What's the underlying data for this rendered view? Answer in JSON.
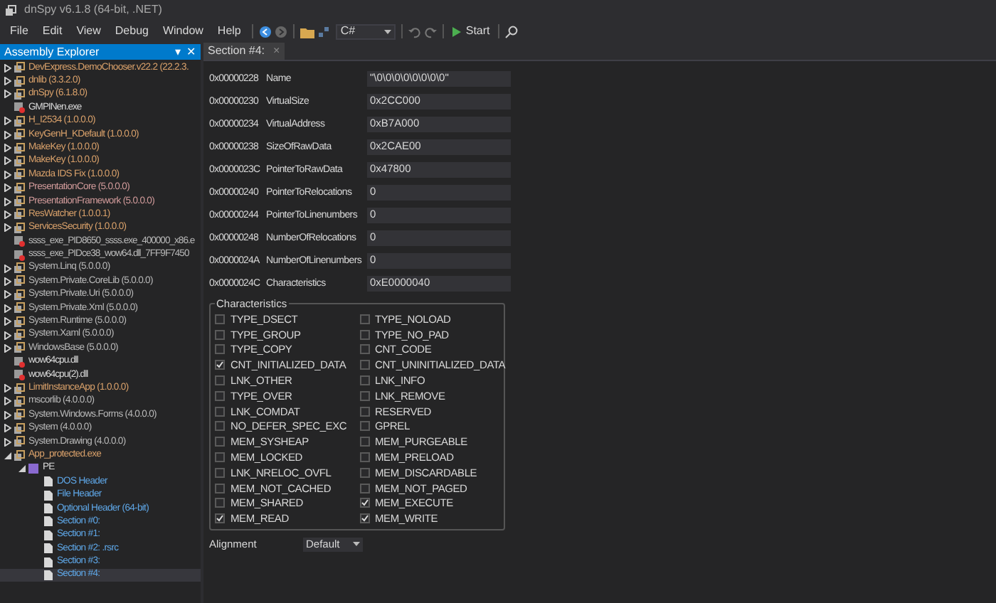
{
  "window": {
    "title": "dnSpy v6.1.8 (64-bit, .NET)"
  },
  "menu": [
    "File",
    "Edit",
    "View",
    "Debug",
    "Window",
    "Help"
  ],
  "toolbar": {
    "language": "C#",
    "start": "Start"
  },
  "explorer": {
    "title": "Assembly Explorer",
    "pin": "▾",
    "close": "✕",
    "items": [
      {
        "label": "DevExpress.DemoChooser.v22.2 (22.2.3.",
        "kind": "assembly",
        "color": "#d8a06a",
        "expanded": false,
        "selected": false
      },
      {
        "label": "dnlib (3.3.2.0)",
        "kind": "assembly",
        "color": "#d8a06a",
        "expanded": false,
        "selected": false
      },
      {
        "label": "dnSpy (6.1.8.0)",
        "kind": "assembly",
        "color": "#d8a06a",
        "expanded": false,
        "selected": false
      },
      {
        "label": "GMPINen.exe",
        "kind": "module",
        "color": "#d8d8d8",
        "selected": false
      },
      {
        "label": "H_I2534 (1.0.0.0)",
        "kind": "assembly",
        "color": "#d8a06a",
        "expanded": false,
        "selected": false
      },
      {
        "label": "KeyGenH_KDefault (1.0.0.0)",
        "kind": "assembly",
        "color": "#d8a06a",
        "expanded": false,
        "selected": false
      },
      {
        "label": "MakeKey (1.0.0.0)",
        "kind": "assembly",
        "color": "#d8a06a",
        "expanded": false,
        "selected": false
      },
      {
        "label": "MakeKey (1.0.0.0)",
        "kind": "assembly",
        "color": "#d8a06a",
        "expanded": false,
        "selected": false
      },
      {
        "label": "Mazda IDS Fix (1.0.0.0)",
        "kind": "assembly",
        "color": "#d8a06a",
        "expanded": false,
        "selected": false
      },
      {
        "label": "PresentationCore (5.0.0.0)",
        "kind": "assembly",
        "color": "#d09a9a",
        "expanded": false,
        "selected": false
      },
      {
        "label": "PresentationFramework (5.0.0.0)",
        "kind": "assembly",
        "color": "#d09a9a",
        "expanded": false,
        "selected": false
      },
      {
        "label": "ResWatcher (1.0.0.1)",
        "kind": "assembly",
        "color": "#d8a06a",
        "expanded": false,
        "selected": false
      },
      {
        "label": "ServicesSecurity (1.0.0.0)",
        "kind": "assembly",
        "color": "#d8a06a",
        "expanded": false,
        "selected": false
      },
      {
        "label": "ssss_exe_PID8650_ssss.exe_400000_x86.e",
        "kind": "module",
        "color": "#b8b8b8",
        "selected": false
      },
      {
        "label": "ssss_exe_PIDce38_wow64.dll_7FF9F7450",
        "kind": "module",
        "color": "#b8b8b8",
        "selected": false
      },
      {
        "label": "System.Linq (5.0.0.0)",
        "kind": "assembly",
        "color": "#b8b8b8",
        "expanded": false,
        "selected": false
      },
      {
        "label": "System.Private.CoreLib (5.0.0.0)",
        "kind": "assembly",
        "color": "#b8b8b8",
        "expanded": false,
        "selected": false
      },
      {
        "label": "System.Private.Uri (5.0.0.0)",
        "kind": "assembly",
        "color": "#b8b8b8",
        "expanded": false,
        "selected": false
      },
      {
        "label": "System.Private.Xml (5.0.0.0)",
        "kind": "assembly",
        "color": "#b8b8b8",
        "expanded": false,
        "selected": false
      },
      {
        "label": "System.Runtime (5.0.0.0)",
        "kind": "assembly",
        "color": "#b8b8b8",
        "expanded": false,
        "selected": false
      },
      {
        "label": "System.Xaml (5.0.0.0)",
        "kind": "assembly",
        "color": "#b8b8b8",
        "expanded": false,
        "selected": false
      },
      {
        "label": "WindowsBase (5.0.0.0)",
        "kind": "assembly",
        "color": "#b8b8b8",
        "expanded": false,
        "selected": false
      },
      {
        "label": "wow64cpu.dll",
        "kind": "module",
        "color": "#d8d8d8",
        "selected": false
      },
      {
        "label": "wow64cpu(2).dll",
        "kind": "module",
        "color": "#d8d8d8",
        "selected": false
      },
      {
        "label": "LimitInstanceApp (1.0.0.0)",
        "kind": "assembly",
        "color": "#d8a06a",
        "expanded": false,
        "selected": false
      },
      {
        "label": "mscorlib (4.0.0.0)",
        "kind": "assembly",
        "color": "#b8b8b8",
        "expanded": false,
        "selected": false
      },
      {
        "label": "System.Windows.Forms (4.0.0.0)",
        "kind": "assembly",
        "color": "#b8b8b8",
        "expanded": false,
        "selected": false
      },
      {
        "label": "System (4.0.0.0)",
        "kind": "assembly",
        "color": "#b8b8b8",
        "expanded": false,
        "selected": false
      },
      {
        "label": "System.Drawing (4.0.0.0)",
        "kind": "assembly",
        "color": "#b8b8b8",
        "expanded": false,
        "selected": false
      },
      {
        "label": "App_protected.exe",
        "kind": "assembly",
        "color": "#d8a06a",
        "expanded": true,
        "selected": false,
        "children": [
          {
            "label": "PE",
            "kind": "pe",
            "color": "#d8d8d8",
            "expanded": true,
            "selected": false,
            "children": [
              {
                "label": "DOS Header",
                "kind": "file",
                "color": "#5ea6e6",
                "selected": false
              },
              {
                "label": "File Header",
                "kind": "file",
                "color": "#5ea6e6",
                "selected": false
              },
              {
                "label": "Optional Header (64-bit)",
                "kind": "file",
                "color": "#5ea6e6",
                "selected": false
              },
              {
                "label": "Section #0:",
                "kind": "file",
                "color": "#5ea6e6",
                "selected": false
              },
              {
                "label": "Section #1:",
                "kind": "file",
                "color": "#5ea6e6",
                "selected": false
              },
              {
                "label": "Section #2: .rsrc",
                "kind": "file",
                "color": "#5ea6e6",
                "selected": false
              },
              {
                "label": "Section #3:",
                "kind": "file",
                "color": "#5ea6e6",
                "selected": false
              },
              {
                "label": "Section #4:",
                "kind": "file",
                "color": "#5ea6e6",
                "selected": true
              }
            ]
          }
        ]
      }
    ]
  },
  "tab": {
    "label": "Section #4:",
    "close": "×"
  },
  "fields": [
    {
      "offset": "0x00000228",
      "name": "Name",
      "value": "\"\\0\\0\\0\\0\\0\\0\\0\\0\""
    },
    {
      "offset": "0x00000230",
      "name": "VirtualSize",
      "value": "0x2CC000"
    },
    {
      "offset": "0x00000234",
      "name": "VirtualAddress",
      "value": "0xB7A000"
    },
    {
      "offset": "0x00000238",
      "name": "SizeOfRawData",
      "value": "0x2CAE00"
    },
    {
      "offset": "0x0000023C",
      "name": "PointerToRawData",
      "value": "0x47800"
    },
    {
      "offset": "0x00000240",
      "name": "PointerToRelocations",
      "value": "0"
    },
    {
      "offset": "0x00000244",
      "name": "PointerToLinenumbers",
      "value": "0"
    },
    {
      "offset": "0x00000248",
      "name": "NumberOfRelocations",
      "value": "0"
    },
    {
      "offset": "0x0000024A",
      "name": "NumberOfLinenumbers",
      "value": "0"
    },
    {
      "offset": "0x0000024C",
      "name": "Characteristics",
      "value": "0xE0000040"
    }
  ],
  "characteristics": {
    "title": "Characteristics",
    "flags": [
      {
        "label": "TYPE_DSECT",
        "checked": false
      },
      {
        "label": "TYPE_NOLOAD",
        "checked": false
      },
      {
        "label": "TYPE_GROUP",
        "checked": false
      },
      {
        "label": "TYPE_NO_PAD",
        "checked": false
      },
      {
        "label": "TYPE_COPY",
        "checked": false
      },
      {
        "label": "CNT_CODE",
        "checked": false
      },
      {
        "label": "CNT_INITIALIZED_DATA",
        "checked": true
      },
      {
        "label": "CNT_UNINITIALIZED_DATA",
        "checked": false
      },
      {
        "label": "LNK_OTHER",
        "checked": false
      },
      {
        "label": "LNK_INFO",
        "checked": false
      },
      {
        "label": "TYPE_OVER",
        "checked": false
      },
      {
        "label": "LNK_REMOVE",
        "checked": false
      },
      {
        "label": "LNK_COMDAT",
        "checked": false
      },
      {
        "label": "RESERVED",
        "checked": false
      },
      {
        "label": "NO_DEFER_SPEC_EXC",
        "checked": false
      },
      {
        "label": "GPREL",
        "checked": false
      },
      {
        "label": "MEM_SYSHEAP",
        "checked": false
      },
      {
        "label": "MEM_PURGEABLE",
        "checked": false
      },
      {
        "label": "MEM_LOCKED",
        "checked": false
      },
      {
        "label": "MEM_PRELOAD",
        "checked": false
      },
      {
        "label": "LNK_NRELOC_OVFL",
        "checked": false
      },
      {
        "label": "MEM_DISCARDABLE",
        "checked": false
      },
      {
        "label": "MEM_NOT_CACHED",
        "checked": false
      },
      {
        "label": "MEM_NOT_PAGED",
        "checked": false
      },
      {
        "label": "MEM_SHARED",
        "checked": false
      },
      {
        "label": "MEM_EXECUTE",
        "checked": true
      },
      {
        "label": "MEM_READ",
        "checked": true
      },
      {
        "label": "MEM_WRITE",
        "checked": true
      }
    ]
  },
  "alignment": {
    "label": "Alignment",
    "value": "Default"
  }
}
